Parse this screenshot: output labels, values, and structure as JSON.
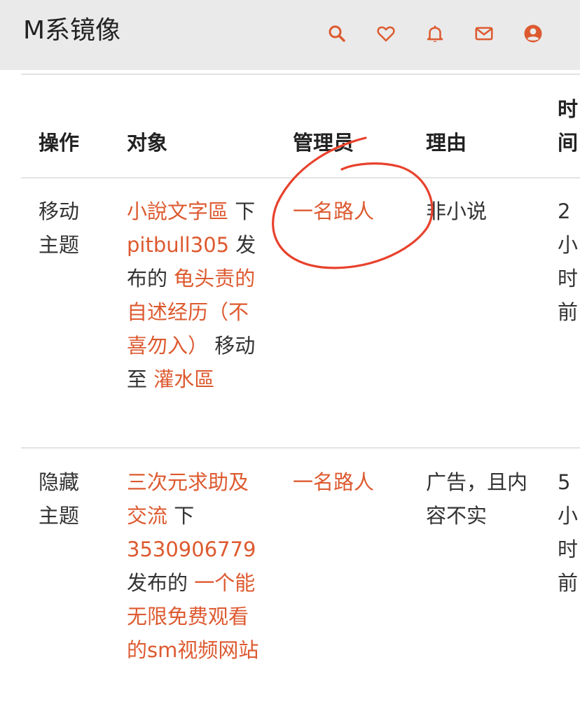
{
  "header": {
    "title": "M系镜像",
    "icons": [
      "search-icon",
      "heart-icon",
      "bell-icon",
      "mail-icon",
      "user-icon"
    ],
    "accent_color": "#dd5a30"
  },
  "table": {
    "columns": {
      "operation": "操作",
      "target": "对象",
      "admin": "管理员",
      "reason": "理由",
      "time": "时间"
    },
    "rows": [
      {
        "operation": "移动主题",
        "target": {
          "board": "小說文字區",
          "sep1": " 下 ",
          "user": "pitbull305",
          "sep2": " 发布的 ",
          "topic": "龟头责的自述经历（不喜勿入）",
          "sep3": " 移动至 ",
          "dest": "灌水區"
        },
        "admin": "一名路人",
        "reason": "非小说",
        "time": "2小时前"
      },
      {
        "operation": "隐藏主题",
        "target": {
          "board": "三次元求助及交流",
          "sep1": " 下 ",
          "user": "3530906779",
          "sep2": " 发布的 ",
          "topic": "一个能无限免费观看的sm视频网站"
        },
        "admin": "一名路人",
        "reason": "广告，且内容不实",
        "time": "5小时前"
      }
    ]
  },
  "annotation_color": "#e8412c"
}
